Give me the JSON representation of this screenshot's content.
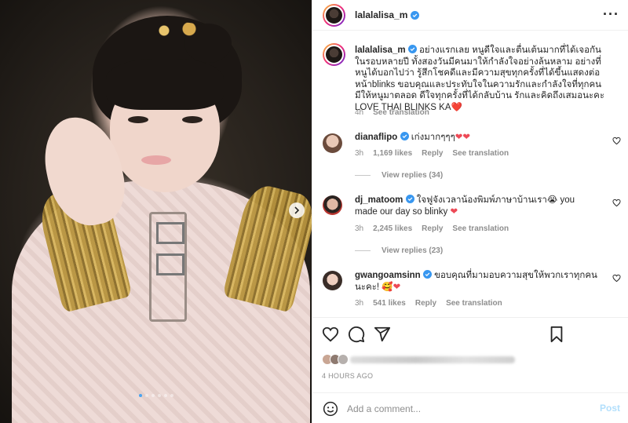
{
  "post": {
    "username": "lalalalisa_m",
    "image_count": 6,
    "active_image": 1
  },
  "caption": {
    "username": "lalalalisa_m",
    "text": "อย่างแรกเลย หนูดีใจและตื่นเต้นมากที่ได้เจอกันในรอบหลายปี ทั้งสองวันมีคนมาให้กำลังใจอย่างล้นหลาม อย่างที่หนูได้บอกไปว่า รู้สึกโชคดีและมีความสุขทุกครั้งที่ได้ขึ้นแสดงต่อหน้าblinks ขอบคุณและประทับใจในความรักและกำลังใจที่ทุกคนมีให้หนูมาตลอด ดีใจทุกครั้งที่ได้กลับบ้าน รักและคิดถึงเสมอนะคะ LOVE THAI BLINKS KA",
    "emoji": "❤️",
    "time": "4h",
    "see_translation": "See translation"
  },
  "comments": [
    {
      "username": "dianaflipo",
      "text": "เก่งมากๆๆๆ",
      "emoji": "❤❤",
      "time": "3h",
      "likes": "1,169 likes",
      "reply": "Reply",
      "see_translation": "See translation",
      "view_replies": "View replies (34)"
    },
    {
      "username": "dj_matoom",
      "text": "ใจฟูจังเวลาน้องพิมพ์ภาษาบ้านเรา😭 you made our day so blinky",
      "emoji": "❤",
      "time": "3h",
      "likes": "2,245 likes",
      "reply": "Reply",
      "see_translation": "See translation",
      "view_replies": "View replies (23)"
    },
    {
      "username": "gwangoamsinn",
      "text": "ขอบคุณที่มามอบความสุขให้พวกเราทุกคนนะคะ!",
      "emoji": "🥰❤",
      "time": "3h",
      "likes": "541 likes",
      "reply": "Reply",
      "see_translation": "See translation"
    }
  ],
  "timestamp": "4 HOURS AGO",
  "comment_box": {
    "placeholder": "Add a comment...",
    "post_label": "Post"
  },
  "icons": {
    "verified": "verified-badge-icon",
    "more": "more-options-icon",
    "like": "heart-icon",
    "comment": "comment-icon",
    "share": "send-icon",
    "save": "bookmark-icon",
    "emoji": "smile-icon"
  },
  "colors": {
    "verified": "#3897f0",
    "muted": "#8e8e8e",
    "text": "#262626",
    "heart": "#ed4956",
    "post_disabled": "#b2dffc",
    "carousel_active": "#4aa3f0"
  }
}
